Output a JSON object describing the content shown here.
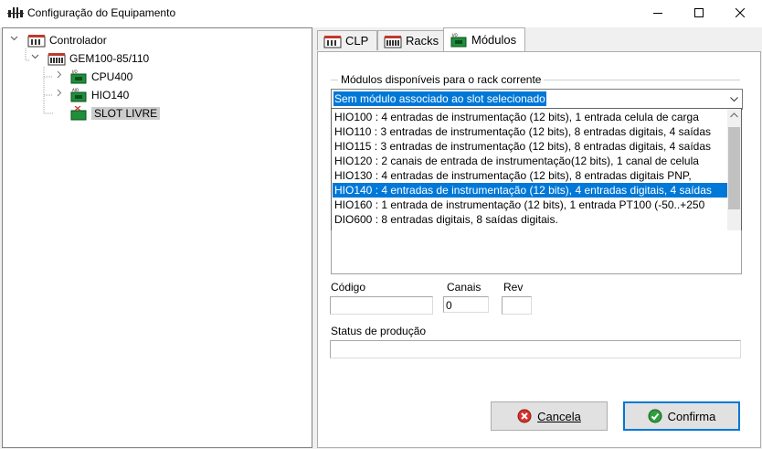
{
  "window": {
    "title": "Configuração do Equipamento"
  },
  "tree": {
    "root": "Controlador",
    "rack": "GEM100-85/110",
    "modules": [
      {
        "label": "CPU400"
      },
      {
        "label": "HIO140"
      },
      {
        "label": "SLOT LIVRE"
      }
    ]
  },
  "tabs": [
    {
      "label": "CLP"
    },
    {
      "label": "Racks"
    },
    {
      "label": "Módulos",
      "active": true
    }
  ],
  "modules_tab": {
    "group_label": "Módulos disponíveis para o rack corrente",
    "combo_value": "Sem módulo associado ao slot selecionado",
    "options": [
      "HIO100 : 4 entradas de instrumentação (12 bits), 1 entrada celula de carga",
      "HIO110 : 3 entradas de instrumentação (12 bits), 8 entradas digitais, 4 saídas",
      "HIO115 : 3 entradas de instrumentação (12 bits), 8 entradas digitais, 4 saídas",
      "HIO120 : 2 canais de entrada de instrumentação(12 bits), 1 canal de celula",
      "HIO130 : 4 entradas de instrumentação (12 bits), 8 entradas digitais PNP,",
      "HIO140 : 4 entradas de instrumentação (12 bits), 4 entradas digitais, 4 saídas",
      "HIO160 : 1 entrada de instrumentação (12 bits), 1 entrada PT100 (-50..+250",
      "DIO600 : 8 entradas digitais, 8 saídas digitais."
    ],
    "selected_option_index": 5,
    "fields": {
      "codigo_label": "Código",
      "codigo_value": "",
      "canais_label": "Canais",
      "canais_value": "0",
      "rev_label": "Rev",
      "rev_value": "",
      "status_label": "Status de produção",
      "status_value": ""
    },
    "buttons": {
      "cancel": "Cancela",
      "confirm": "Confirma"
    }
  },
  "colors": {
    "selection": "#0078d7",
    "cancel_icon": "#d9312b",
    "confirm_icon": "#2e9e3e"
  }
}
